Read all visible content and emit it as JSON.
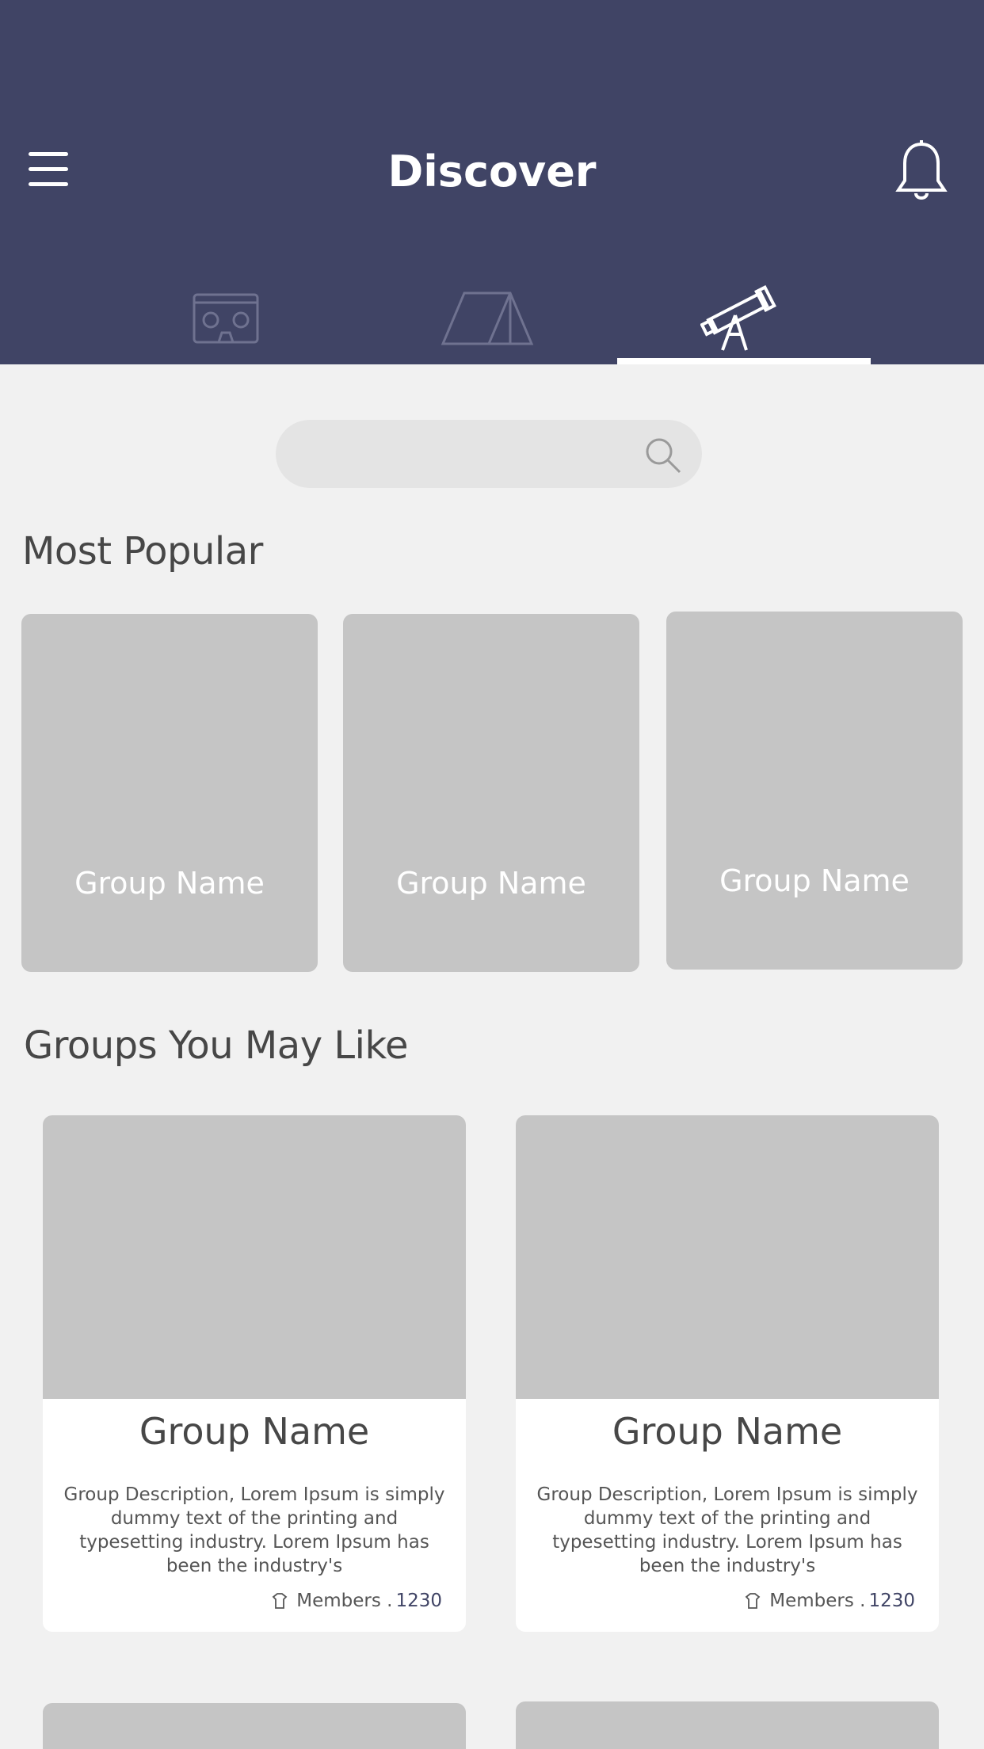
{
  "header": {
    "title": "Discover",
    "menu_icon": "hamburger-menu-icon",
    "notification_icon": "bell-icon",
    "tabs": [
      {
        "icon": "vr-headset-icon",
        "active": false
      },
      {
        "icon": "tent-icon",
        "active": false
      },
      {
        "icon": "telescope-icon",
        "active": true
      }
    ]
  },
  "search": {
    "placeholder": "",
    "value": "",
    "icon": "search-icon"
  },
  "most_popular": {
    "title": "Most Popular",
    "groups": [
      {
        "name": "Group Name"
      },
      {
        "name": "Group Name"
      },
      {
        "name": "Group Name"
      }
    ]
  },
  "groups_you_may_like": {
    "title": "Groups You May Like",
    "groups": [
      {
        "name": "Group Name",
        "description": "Group Description, Lorem Ipsum is simply dummy text of the printing and typesetting industry. Lorem Ipsum has been the industry's",
        "members_label": "Members .",
        "members_count": "1230"
      },
      {
        "name": "Group Name",
        "description": "Group Description, Lorem Ipsum is simply dummy text of the printing and typesetting industry. Lorem Ipsum has been the industry's",
        "members_label": "Members .",
        "members_count": "1230"
      }
    ]
  },
  "colors": {
    "header_bg": "#404465",
    "page_bg": "#f1f1f1",
    "placeholder_gray": "#c5c5c5",
    "text_dark": "#474747"
  }
}
